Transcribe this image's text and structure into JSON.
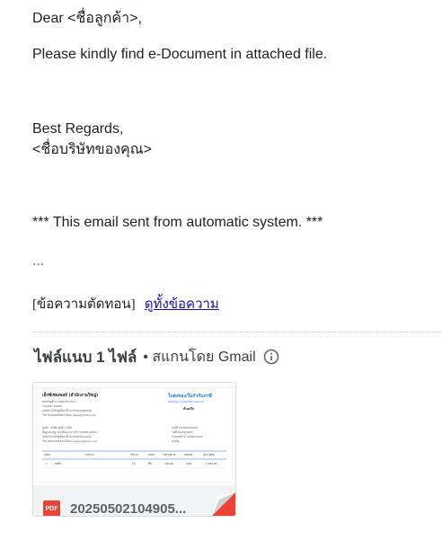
{
  "email": {
    "greeting": "Dear <ชื่อลูกค้า>,",
    "body": "Please kindly find e-Document in attached file.",
    "closing": "Best Regards,",
    "company_placeholder": "<ชื่อบริษัทของคุณ>",
    "notice": "*** This email sent from automatic system. ***",
    "ellipsis": "..."
  },
  "trimmed": {
    "label": "[ข้อความตัดทอน]",
    "link": "ดูทั้งข้อความ"
  },
  "attachments": {
    "title": "ไฟล์แนบ 1 ไฟล์",
    "scan_note": "• สแกนโดย Gmail",
    "files": [
      {
        "name": "20250502104905...",
        "type_badge": "PDF",
        "preview": {
          "company": "เอ็กซ์เซลเพลย์ (สำนักงานใหญ่)",
          "doc_title": "ใบส่งของ/ใบกำกับภาษี",
          "doc_subtitle": "Delivery Order/Tax Invoice",
          "copy_label": "ต้นฉบับ",
          "company_lines": [
            "999 หมู่ที่ 9 ถ.สุขุมวิท แขวง...",
            "กรุงเทพฯ 10000",
            "เลขประจำตัวผู้เสียภาษี 0105567999999",
            "โทร 0999999999 อีเมล sales@email.com"
          ],
          "customer_lines": [
            "ลูกค้า: บริษัท ลูกค้า จำกัด",
            "ที่อยู่ 99 หมู่ 9 ต.สีลม อ.บางรัก กรุงเทพ 10500",
            "เลขประจำตัวผู้เสียภาษี 0105567011223",
            "โทร 0812345678 อีเมล buyer@email.com"
          ],
          "meta_lines": [
            "เลขที่ IV2025050001",
            "วันที่ 02/05/2025",
            "กำหนดชำระ 02/05/2025",
            "อ้างอิง -"
          ],
          "table_headers": [
            "ลำดับ",
            "รายการ",
            "จำนวน",
            "หน่วย",
            "ราคา/หน่วย",
            "ส่วนลด",
            "จำนวนเงิน"
          ],
          "table_row": [
            "1",
            "สินค้า",
            "10",
            "ชิ้น",
            "100.00",
            "0.00",
            "1,000.00"
          ]
        }
      }
    ]
  },
  "colors": {
    "link": "#1a0dab",
    "pdf_red": "#ea4335",
    "preview_blue": "#1a73e8"
  }
}
